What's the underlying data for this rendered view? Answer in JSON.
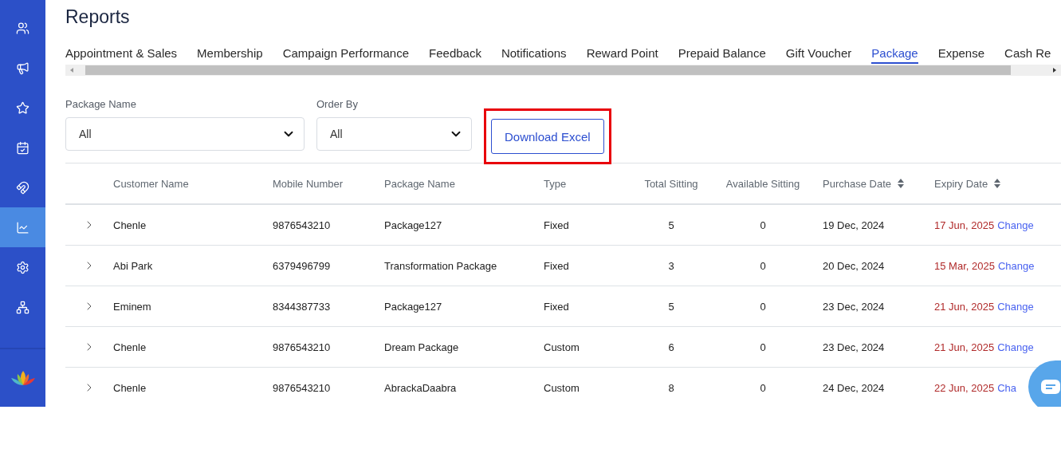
{
  "title": "Reports",
  "tabs": [
    {
      "label": "Appointment & Sales",
      "selected": false
    },
    {
      "label": "Membership",
      "selected": false
    },
    {
      "label": "Campaign Performance",
      "selected": false
    },
    {
      "label": "Feedback",
      "selected": false
    },
    {
      "label": "Notifications",
      "selected": false
    },
    {
      "label": "Reward Point",
      "selected": false
    },
    {
      "label": "Prepaid Balance",
      "selected": false
    },
    {
      "label": "Gift Voucher",
      "selected": false
    },
    {
      "label": "Package",
      "selected": true
    },
    {
      "label": "Expense",
      "selected": false
    },
    {
      "label": "Cash Re",
      "selected": false
    }
  ],
  "sidebar": {
    "items": [
      {
        "kind": "users",
        "selected": false
      },
      {
        "kind": "megaphone",
        "selected": false
      },
      {
        "kind": "star",
        "selected": false
      },
      {
        "kind": "calendar",
        "selected": false
      },
      {
        "kind": "magnet",
        "selected": false
      },
      {
        "kind": "chart",
        "selected": true
      },
      {
        "kind": "gear",
        "selected": false
      },
      {
        "kind": "hierarchy",
        "selected": false
      }
    ]
  },
  "filters": [
    {
      "label": "Package Name",
      "value": "All"
    },
    {
      "label": "Order By",
      "value": "All"
    }
  ],
  "download_button": "Download Excel",
  "table": {
    "columns": [
      {
        "label": "Customer Name",
        "sortable": false
      },
      {
        "label": "Mobile Number",
        "sortable": false
      },
      {
        "label": "Package Name",
        "sortable": false
      },
      {
        "label": "Type",
        "sortable": false
      },
      {
        "label": "Total Sitting",
        "sortable": false
      },
      {
        "label": "Available Sitting",
        "sortable": false
      },
      {
        "label": "Purchase Date",
        "sortable": true
      },
      {
        "label": "Expiry Date",
        "sortable": true
      }
    ],
    "rows": [
      {
        "customer": "Chenle",
        "mobile": "9876543210",
        "package": "Package127",
        "type": "Fixed",
        "total": "5",
        "available": "0",
        "purchase": "19 Dec, 2024",
        "expiry": "17 Jun, 2025",
        "change": "Change"
      },
      {
        "customer": "Abi Park",
        "mobile": "6379496799",
        "package": "Transformation Package",
        "type": "Fixed",
        "total": "3",
        "available": "0",
        "purchase": "20 Dec, 2024",
        "expiry": "15 Mar, 2025",
        "change": "Change"
      },
      {
        "customer": "Eminem",
        "mobile": "8344387733",
        "package": "Package127",
        "type": "Fixed",
        "total": "5",
        "available": "0",
        "purchase": "23 Dec, 2024",
        "expiry": "21 Jun, 2025",
        "change": "Change"
      },
      {
        "customer": "Chenle",
        "mobile": "9876543210",
        "package": "Dream Package",
        "type": "Custom",
        "total": "6",
        "available": "0",
        "purchase": "23 Dec, 2024",
        "expiry": "21 Jun, 2025",
        "change": "Change"
      },
      {
        "customer": "Chenle",
        "mobile": "9876543210",
        "package": "AbrackaDaabra",
        "type": "Custom",
        "total": "8",
        "available": "0",
        "purchase": "24 Dec, 2024",
        "expiry": "22 Jun, 2025",
        "change": "Cha"
      }
    ]
  }
}
